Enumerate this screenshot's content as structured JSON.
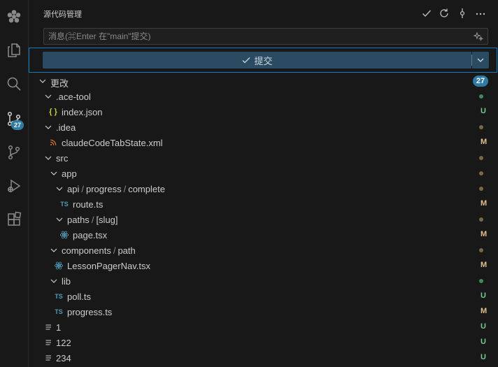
{
  "activity_bar": {
    "items": [
      {
        "name": "app-logo-icon"
      },
      {
        "name": "explorer-icon"
      },
      {
        "name": "search-icon"
      },
      {
        "name": "source-control-icon",
        "badge": "27"
      },
      {
        "name": "git-branch-icon"
      },
      {
        "name": "run-debug-icon"
      },
      {
        "name": "extensions-icon"
      }
    ]
  },
  "header": {
    "title": "源代码管理",
    "actions": [
      "check-icon",
      "refresh-icon",
      "commit-graph-icon",
      "more-icon"
    ]
  },
  "message": {
    "placeholder": "消息(⌘Enter 在\"main\"提交)"
  },
  "commit": {
    "label": "提交"
  },
  "colors": {
    "accent": "#0e7cc0",
    "badge": "#2f7ba3",
    "untracked": "#73c991",
    "modified": "#e2c08d",
    "dot_green": "#3f8a5a",
    "dot_brown": "#7a6648"
  },
  "changes": {
    "label": "更改",
    "count": "27",
    "items": [
      {
        "label": "ace-tool_dir",
        "text": ".ace-tool",
        "type": "folder",
        "level": 1,
        "marker": "dot-green"
      },
      {
        "label": "index-json",
        "text": "index.json",
        "type": "json",
        "level": 2,
        "status": "U"
      },
      {
        "label": "idea_dir",
        "text": ".idea",
        "type": "folder",
        "level": 1,
        "marker": "dot-brown"
      },
      {
        "label": "claude-xml",
        "text": "claudeCodeTabState.xml",
        "type": "rss",
        "level": 2,
        "status": "M"
      },
      {
        "label": "src_dir",
        "text": "src",
        "type": "folder",
        "level": 1,
        "marker": "dot-brown"
      },
      {
        "label": "app_dir",
        "text": "app",
        "type": "folder",
        "level": 2,
        "marker": "dot-brown"
      },
      {
        "label": "api_dir",
        "segments": [
          "api",
          "progress",
          "complete"
        ],
        "type": "folder",
        "level": 3,
        "marker": "dot-brown"
      },
      {
        "label": "route-ts",
        "text": "route.ts",
        "type": "ts",
        "level": 4,
        "status": "M"
      },
      {
        "label": "paths_dir",
        "segments": [
          "paths",
          "[slug]"
        ],
        "type": "folder",
        "level": 3,
        "marker": "dot-brown"
      },
      {
        "label": "page-tsx",
        "text": "page.tsx",
        "type": "react",
        "level": 4,
        "status": "M"
      },
      {
        "label": "components_dir",
        "segments": [
          "components",
          "path"
        ],
        "type": "folder",
        "level": 2,
        "marker": "dot-brown"
      },
      {
        "label": "lessonpager-tsx",
        "text": "LessonPagerNav.tsx",
        "type": "react",
        "level": 3,
        "status": "M"
      },
      {
        "label": "lib_dir",
        "text": "lib",
        "type": "folder",
        "level": 2,
        "marker": "dot-green"
      },
      {
        "label": "poll-ts",
        "text": "poll.ts",
        "type": "ts",
        "level": 3,
        "status": "U"
      },
      {
        "label": "progress-ts",
        "text": "progress.ts",
        "type": "ts",
        "level": 3,
        "status": "M"
      },
      {
        "label": "file-1",
        "text": "1",
        "type": "text",
        "level": 1,
        "status": "U"
      },
      {
        "label": "file-122",
        "text": "122",
        "type": "text",
        "level": 1,
        "status": "U"
      },
      {
        "label": "file-234",
        "text": "234",
        "type": "text",
        "level": 1,
        "status": "U"
      }
    ]
  }
}
